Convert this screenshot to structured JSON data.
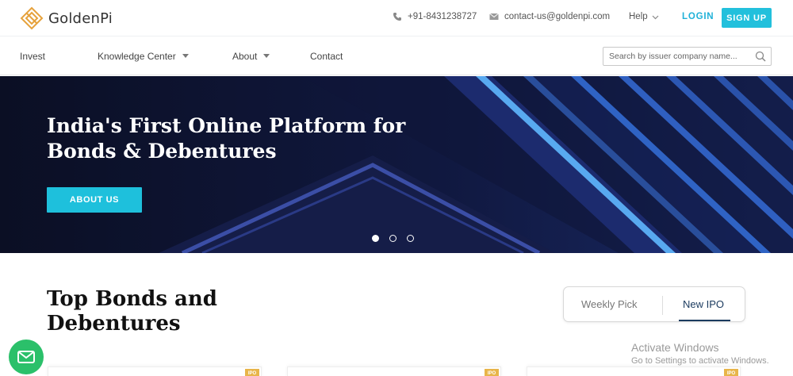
{
  "brand": {
    "name": "GoldenPi",
    "logo_color": "#e6a23c"
  },
  "topbar": {
    "phone": "+91-8431238727",
    "email": "contact-us@goldenpi.com",
    "help_label": "Help",
    "login_label": "LOGIN",
    "signup_label": "SIGN UP",
    "accent": "#22c0dc"
  },
  "nav": {
    "items": [
      {
        "label": "Invest",
        "has_dropdown": false
      },
      {
        "label": "Knowledge Center",
        "has_dropdown": true
      },
      {
        "label": "About",
        "has_dropdown": true
      },
      {
        "label": "Contact",
        "has_dropdown": false
      }
    ],
    "search_placeholder": "Search by issuer company name...",
    "search_icon": "search-icon"
  },
  "hero": {
    "title_line1": "India's First Online Platform for",
    "title_line2": "Bonds & Debentures",
    "button_label": "ABOUT US",
    "slides_total": 3,
    "active_slide": 1
  },
  "section": {
    "title_line1": "Top Bonds and",
    "title_line2": "Debentures",
    "tabs": [
      {
        "label": "Weekly Pick",
        "active": false
      },
      {
        "label": "New IPO",
        "active": true
      }
    ]
  },
  "cards": [
    {
      "badge": "IPO"
    },
    {
      "badge": "IPO"
    },
    {
      "badge": "IPO"
    }
  ],
  "fab": {
    "icon": "mail-icon",
    "color": "#2bc06a"
  },
  "watermark": {
    "line1": "Activate Windows",
    "line2": "Go to Settings to activate Windows."
  }
}
